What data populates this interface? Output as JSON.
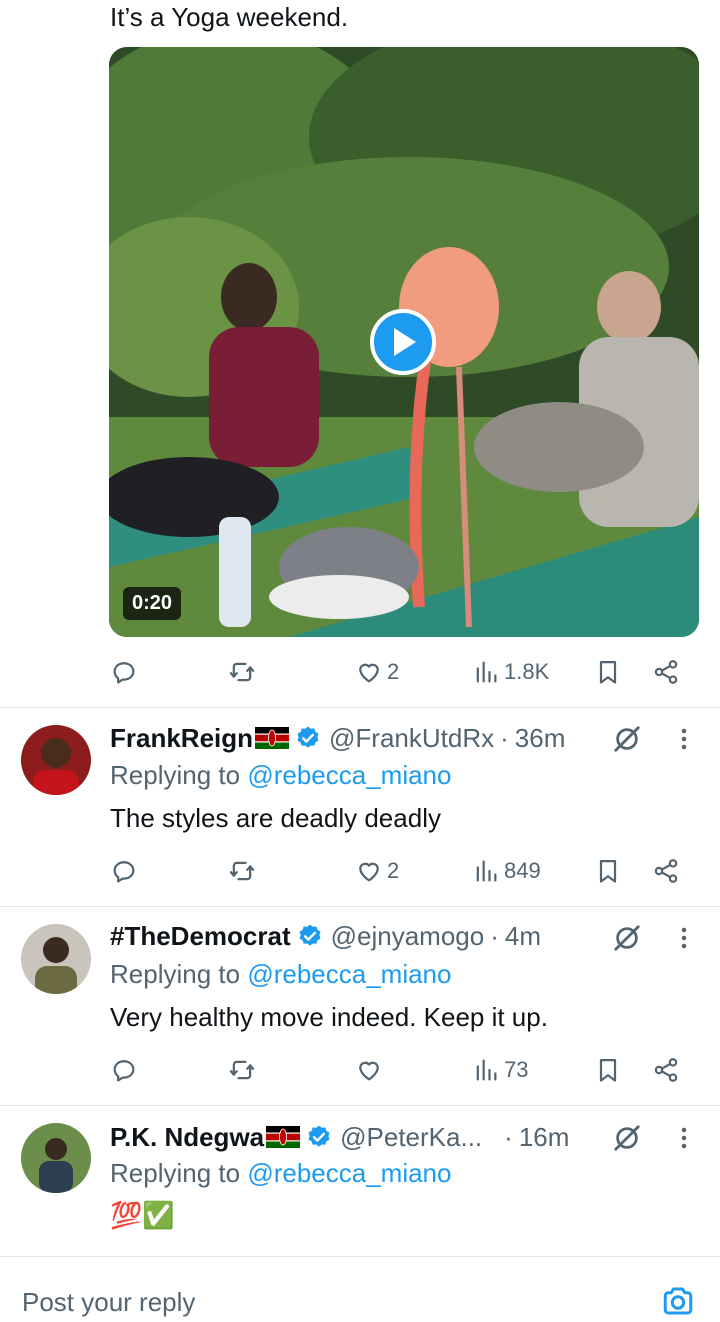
{
  "post": {
    "text": "It’s a Yoga weekend.",
    "video_duration": "0:20",
    "replies_count": "",
    "reposts_count": "",
    "likes_count": "2",
    "views_count": "1.8K"
  },
  "replies": [
    {
      "name": "FrankReign",
      "flag": "kenya-flag",
      "handle": "@FrankUtdRx",
      "time": "36m",
      "replying_prefix": "Replying to ",
      "replying_to": "@rebecca_miano",
      "text": "The styles are deadly deadly",
      "likes": "2",
      "views": "849"
    },
    {
      "name": "#TheDemocrat",
      "flag": "",
      "handle": "@ejnyamogo",
      "time": "4m",
      "replying_prefix": "Replying to ",
      "replying_to": "@rebecca_miano",
      "text": "Very healthy move indeed. Keep it up.",
      "likes": "",
      "views": "73"
    },
    {
      "name": "P.K. Ndegwa",
      "flag": "kenya-flag",
      "handle": "@PeterKa...",
      "time": "16m",
      "replying_prefix": "Replying to ",
      "replying_to": "@rebecca_miano",
      "text": "💯✅"
    }
  ],
  "composer": {
    "placeholder": "Post your reply"
  },
  "icons": {
    "reply": "reply-icon",
    "repost": "repost-icon",
    "like": "heart-icon",
    "views": "views-icon",
    "bookmark": "bookmark-icon",
    "share": "share-icon",
    "verified": "verified-badge-icon",
    "grok": "grok-icon",
    "more": "more-icon",
    "camera": "camera-icon"
  },
  "colors": {
    "accent": "#1d9bf0",
    "muted": "#536471",
    "text": "#0f1419",
    "divider": "#e1e6ea"
  }
}
